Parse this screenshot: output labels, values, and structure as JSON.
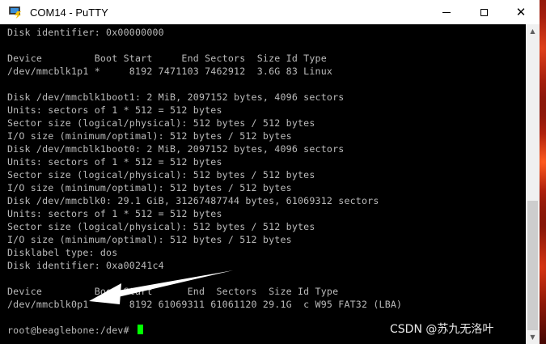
{
  "window": {
    "title": "COM14 - PuTTY",
    "app_icon": "putty-icon",
    "controls": {
      "minimize": "minimize-icon",
      "maximize": "maximize-icon",
      "close": "close-icon"
    }
  },
  "terminal": {
    "lines": [
      "Disk identifier: 0x00000000",
      "",
      "Device         Boot Start     End Sectors  Size Id Type",
      "/dev/mmcblk1p1 *     8192 7471103 7462912  3.6G 83 Linux",
      "",
      "Disk /dev/mmcblk1boot1: 2 MiB, 2097152 bytes, 4096 sectors",
      "Units: sectors of 1 * 512 = 512 bytes",
      "Sector size (logical/physical): 512 bytes / 512 bytes",
      "I/O size (minimum/optimal): 512 bytes / 512 bytes",
      "Disk /dev/mmcblk1boot0: 2 MiB, 2097152 bytes, 4096 sectors",
      "Units: sectors of 1 * 512 = 512 bytes",
      "Sector size (logical/physical): 512 bytes / 512 bytes",
      "I/O size (minimum/optimal): 512 bytes / 512 bytes",
      "Disk /dev/mmcblk0: 29.1 GiB, 31267487744 bytes, 61069312 sectors",
      "Units: sectors of 1 * 512 = 512 bytes",
      "Sector size (logical/physical): 512 bytes / 512 bytes",
      "I/O size (minimum/optimal): 512 bytes / 512 bytes",
      "Disklabel type: dos",
      "Disk identifier: 0xa00241c4",
      "",
      "Device         Boot Start      End  Sectors  Size Id Type",
      "/dev/mmcblk0p1       8192 61069311 61061120 29.1G  c W95 FAT32 (LBA)",
      ""
    ],
    "prompt": "root@beaglebone:/dev# "
  },
  "watermark": "CSDN @苏九无洛叶",
  "colors": {
    "terminal_text": "#bbbbbb",
    "cursor": "#00ff00",
    "background": "#000000"
  }
}
